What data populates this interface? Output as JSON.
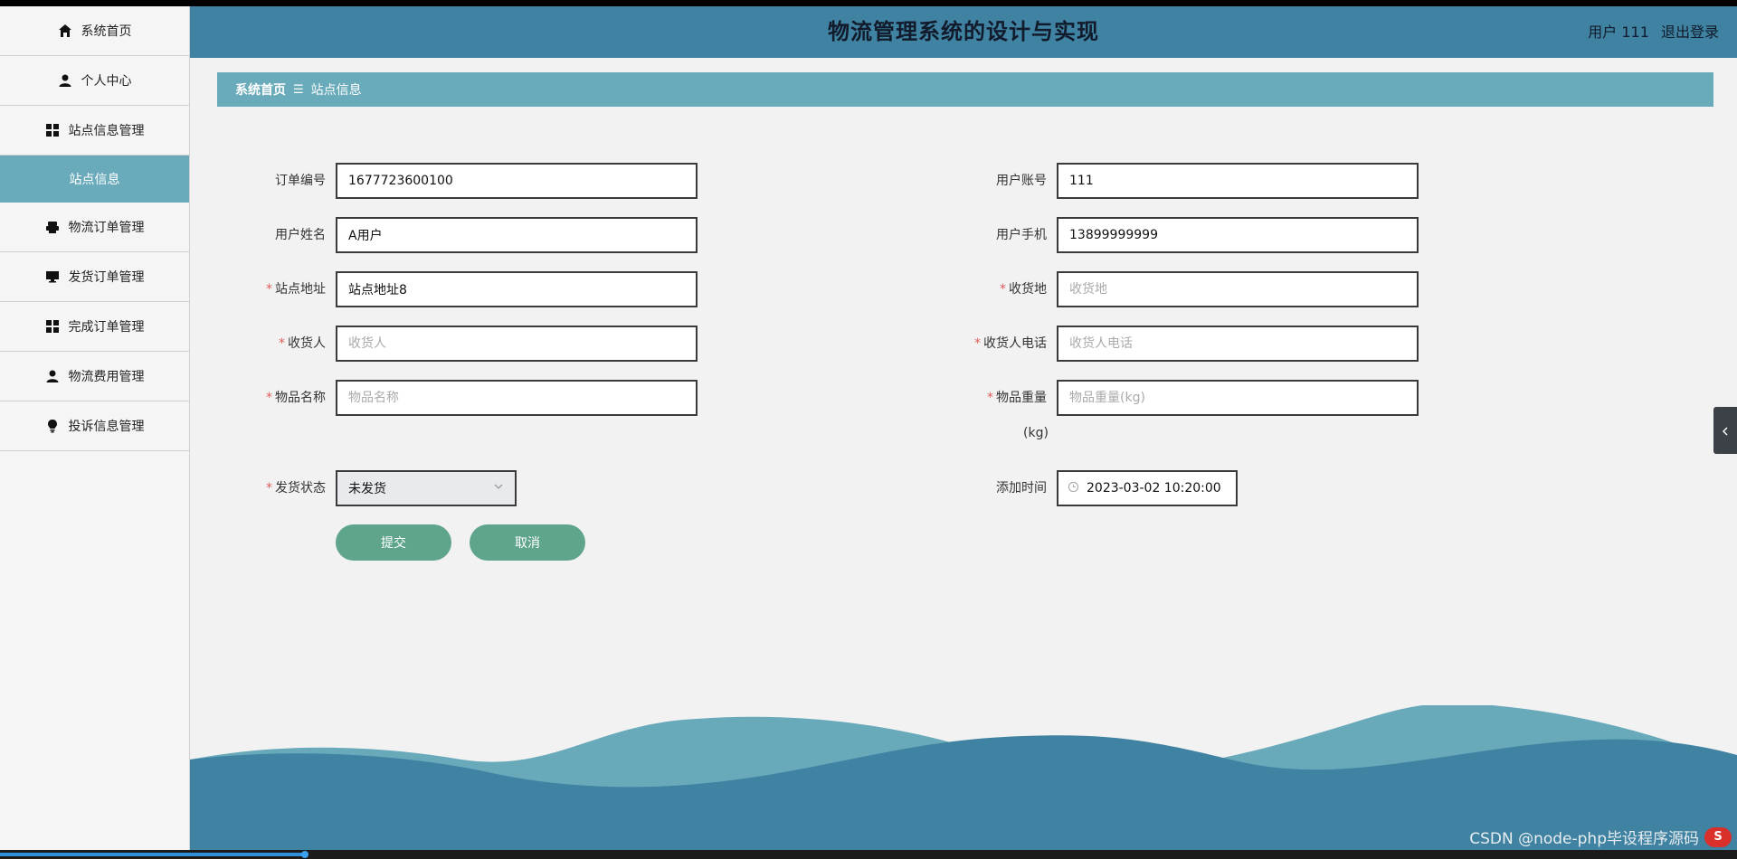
{
  "app": {
    "title": "物流管理系统的设计与实现",
    "user_label": "用户 111",
    "logout_label": "退出登录"
  },
  "sidebar": {
    "items": [
      {
        "label": "系统首页",
        "icon": "home-icon"
      },
      {
        "label": "个人中心",
        "icon": "person-icon"
      },
      {
        "label": "站点信息管理",
        "icon": "grid-icon"
      },
      {
        "label": "站点信息",
        "icon": "",
        "active": true
      },
      {
        "label": "物流订单管理",
        "icon": "printer-icon"
      },
      {
        "label": "发货订单管理",
        "icon": "monitor-icon"
      },
      {
        "label": "完成订单管理",
        "icon": "grid-icon"
      },
      {
        "label": "物流费用管理",
        "icon": "person-icon"
      },
      {
        "label": "投诉信息管理",
        "icon": "bulb-icon"
      }
    ]
  },
  "breadcrumb": {
    "home": "系统首页",
    "separator": "☰",
    "current": "站点信息"
  },
  "form": {
    "order_no": {
      "label": "订单编号",
      "value": "1677723600100"
    },
    "user_account": {
      "label": "用户账号",
      "value": "111"
    },
    "user_name": {
      "label": "用户姓名",
      "value": "A用户"
    },
    "user_phone": {
      "label": "用户手机",
      "value": "13899999999"
    },
    "station_address": {
      "label": "站点地址",
      "value": "站点地址8",
      "required": true
    },
    "receive_place": {
      "label": "收货地",
      "placeholder": "收货地",
      "required": true
    },
    "receiver": {
      "label": "收货人",
      "placeholder": "收货人",
      "required": true
    },
    "receiver_phone": {
      "label": "收货人电话",
      "placeholder": "收货人电话",
      "required": true
    },
    "item_name": {
      "label": "物品名称",
      "placeholder": "物品名称",
      "required": true
    },
    "item_weight": {
      "label": "物品重量",
      "placeholder": "物品重量(kg)",
      "unit": "(kg)",
      "required": true
    },
    "ship_status": {
      "label": "发货状态",
      "value": "未发货",
      "required": true
    },
    "add_time": {
      "label": "添加时间",
      "value": "2023-03-02 10:20:00"
    },
    "required_mark": "*"
  },
  "buttons": {
    "submit": "提交",
    "cancel": "取消"
  },
  "watermark": {
    "text": "CSDN @node-php毕设程序源码",
    "badge": "S"
  },
  "colors": {
    "header": "#3f82a1",
    "accent": "#6aabbb",
    "button": "#5fa58c",
    "required": "#e05a5a"
  }
}
